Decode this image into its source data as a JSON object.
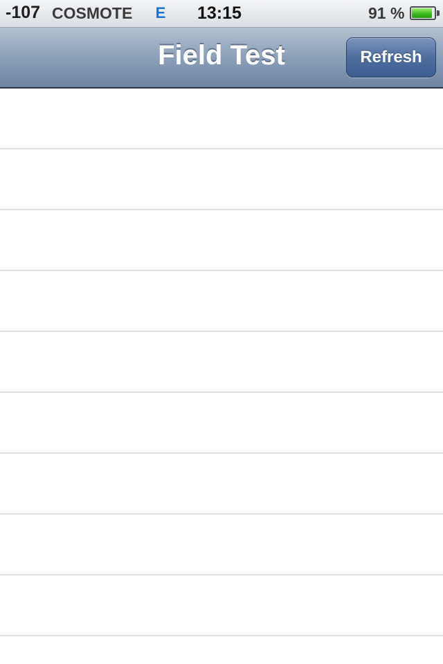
{
  "status_bar": {
    "signal": "-107",
    "carrier": "COSMOTE",
    "network_type": "E",
    "time": "13:15",
    "battery_percent": "91 %",
    "battery_level": 0.91,
    "battery_icon": "battery-icon"
  },
  "nav_bar": {
    "title": "Field Test",
    "refresh_label": "Refresh"
  },
  "table": {
    "rows": [
      "",
      "",
      "",
      "",
      "",
      "",
      "",
      "",
      "",
      ""
    ]
  },
  "colors": {
    "nav_gradient_top": "#b3c0d0",
    "nav_gradient_bottom": "#6d84a1",
    "button_blue": "#4e6d9e",
    "battery_green": "#38b81a",
    "network_blue": "#1f6fd6"
  }
}
